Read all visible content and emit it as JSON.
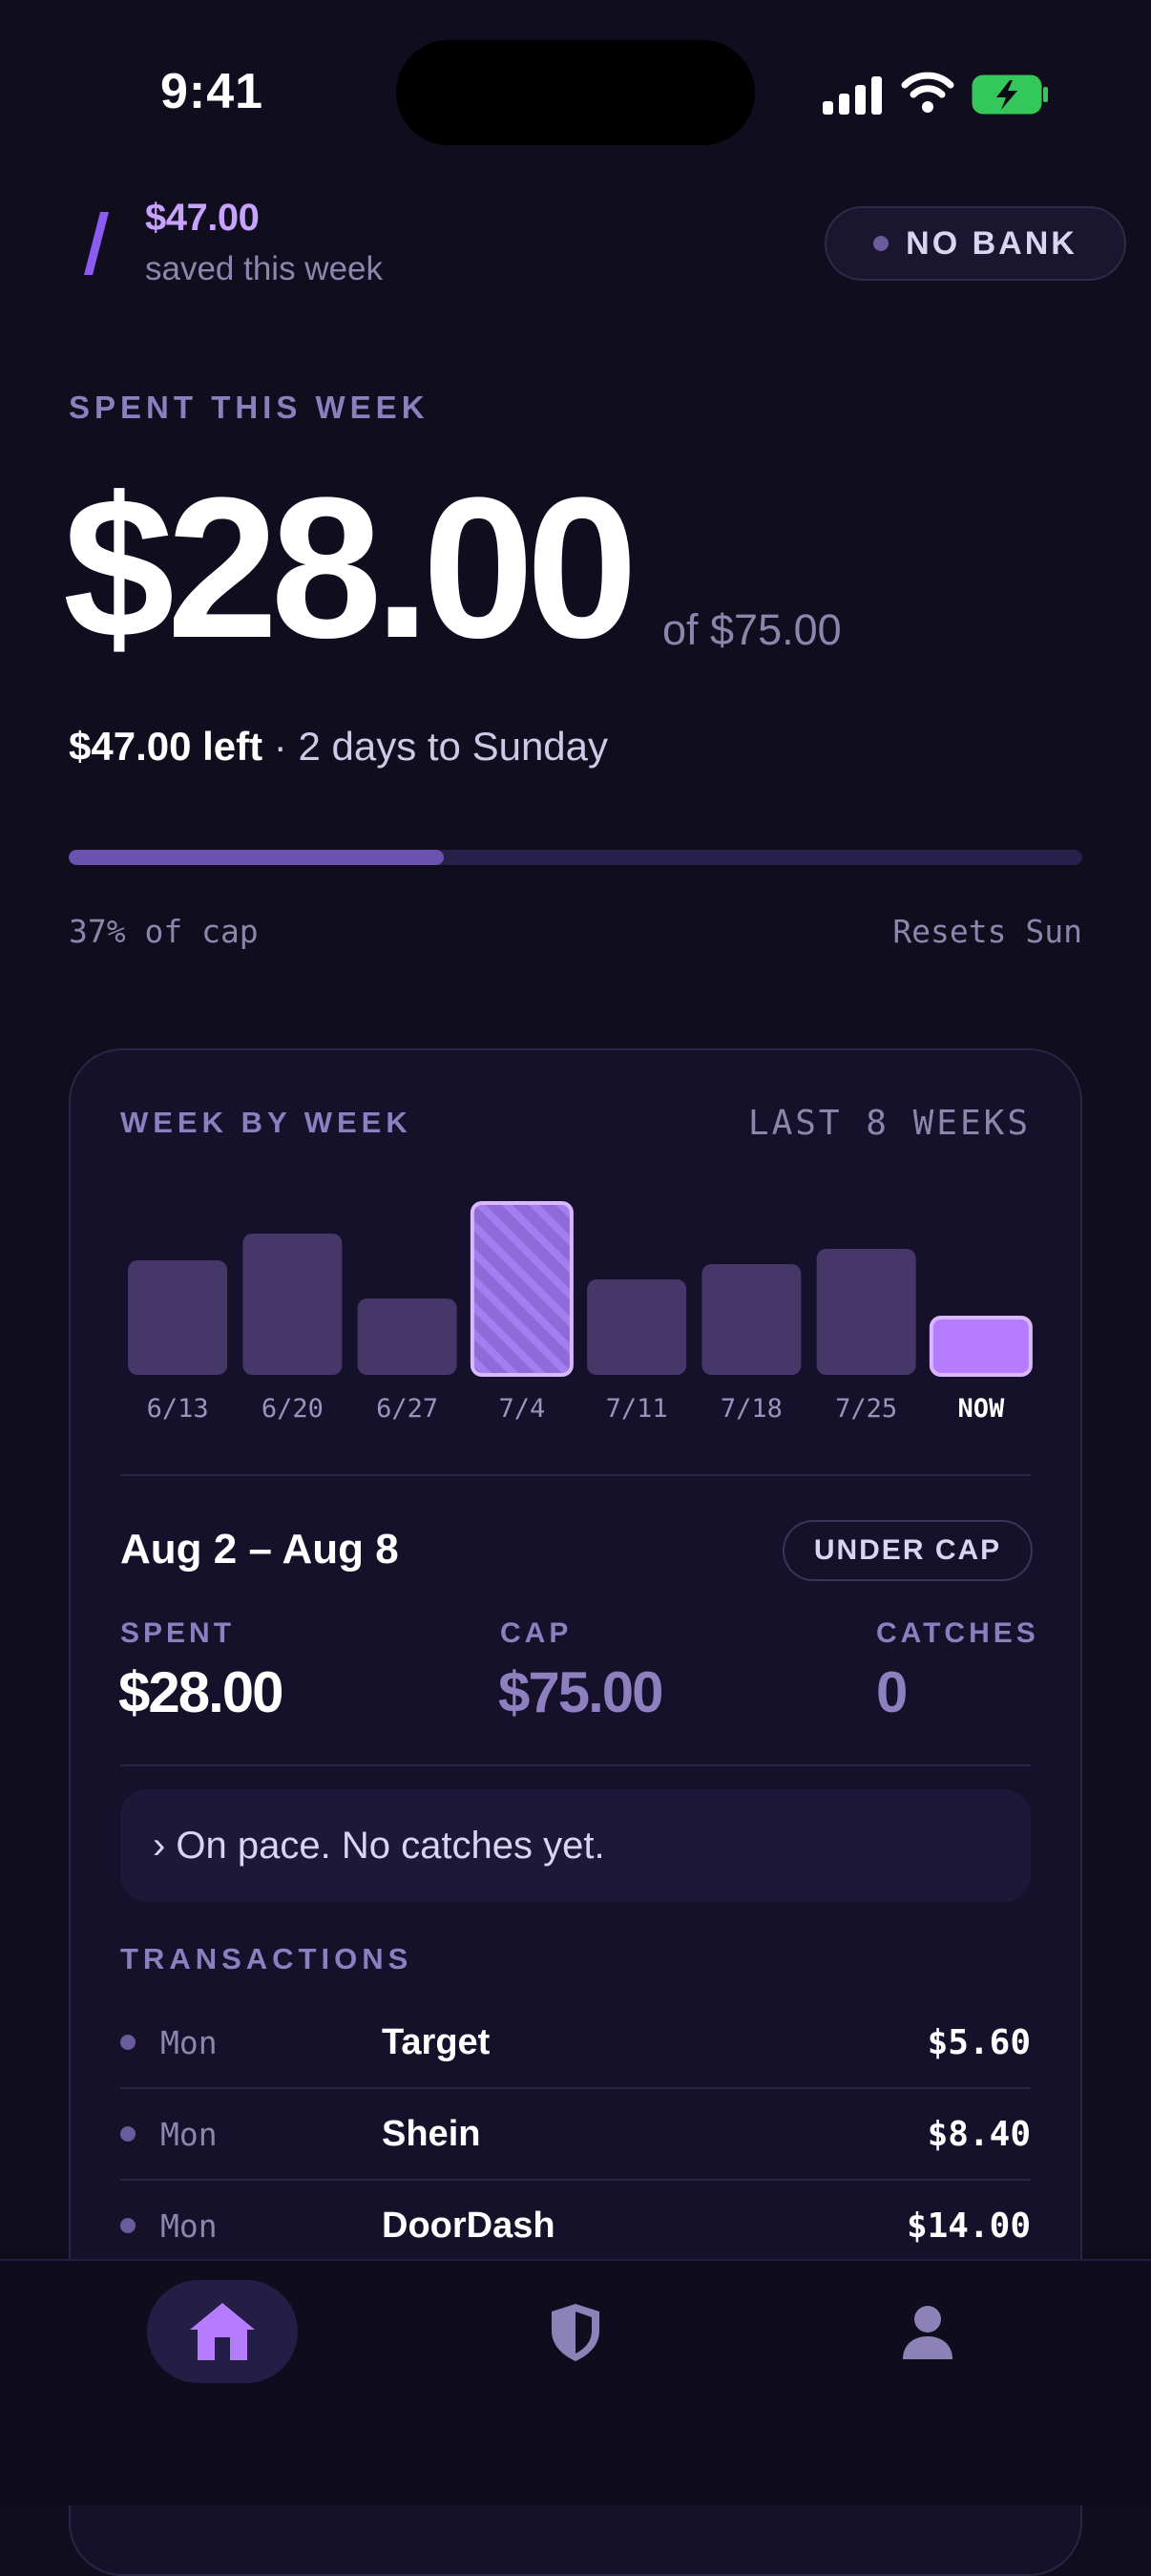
{
  "status_bar": {
    "time": "9:41"
  },
  "header": {
    "saved_amount": "$47.00",
    "saved_label": "saved this week",
    "bank_badge": "NO BANK"
  },
  "spent": {
    "kicker": "SPENT THIS WEEK",
    "amount": "$28.00",
    "of_cap": "of $75.00",
    "left": "$47.00 left",
    "days": " · 2 days to Sunday",
    "progress_fraction": 0.37,
    "progress_label": "37% of cap",
    "resets_label": "Resets Sun"
  },
  "card": {
    "title": "WEEK BY WEEK",
    "range_label": "LAST 8 WEEKS",
    "chart_data": {
      "type": "bar",
      "categories": [
        "6/13",
        "6/20",
        "6/27",
        "7/4",
        "7/11",
        "7/18",
        "7/25",
        "NOW"
      ],
      "values": [
        0.6,
        0.74,
        0.4,
        0.9,
        0.5,
        0.58,
        0.66,
        0.3
      ],
      "highlighted": [
        "7/4",
        "NOW"
      ]
    },
    "week_range": "Aug 2 – Aug 8",
    "status_badge": "UNDER CAP",
    "stats": {
      "spent_label": "SPENT",
      "spent_value": "$28.00",
      "cap_label": "CAP",
      "cap_value": "$75.00",
      "catches_label": "CATCHES",
      "catches_value": "0"
    },
    "note": "› On pace. No catches yet.",
    "transactions_label": "TRANSACTIONS",
    "transactions": [
      {
        "day": "Mon",
        "merchant": "Target",
        "amount": "$5.60"
      },
      {
        "day": "Mon",
        "merchant": "Shein",
        "amount": "$8.40"
      },
      {
        "day": "Mon",
        "merchant": "DoorDash",
        "amount": "$14.00"
      }
    ]
  },
  "tabs": [
    {
      "name": "home",
      "icon": "home-icon"
    },
    {
      "name": "shield",
      "icon": "shield-icon"
    },
    {
      "name": "profile",
      "icon": "person-icon"
    }
  ],
  "colors": {
    "background": "#100d1f",
    "accent": "#b57cff",
    "bar": "#463769",
    "muted": "#8c86ad"
  }
}
